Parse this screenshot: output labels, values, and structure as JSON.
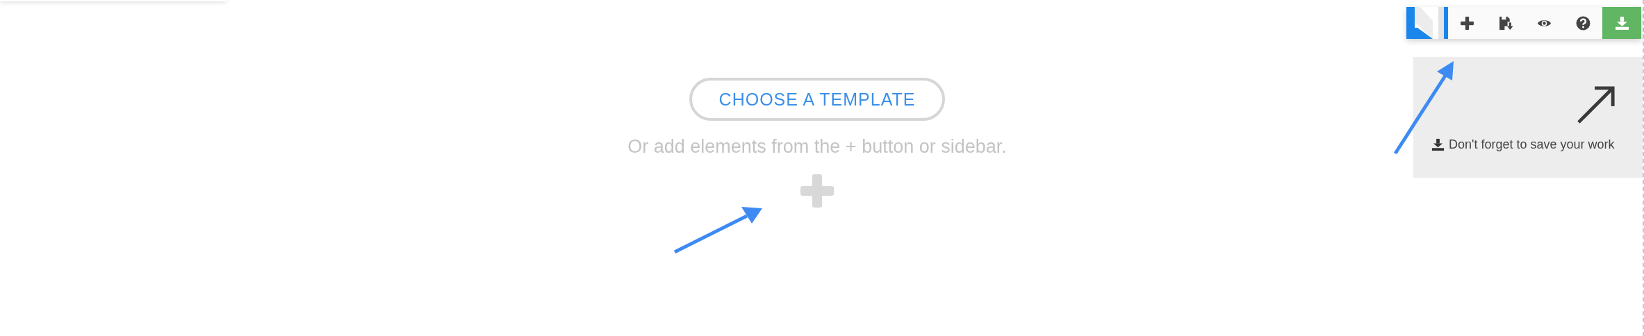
{
  "toolbar": {
    "buttons": [
      {
        "kind": "add"
      },
      {
        "kind": "save"
      },
      {
        "kind": "preview"
      },
      {
        "kind": "help"
      },
      {
        "kind": "download"
      }
    ]
  },
  "empty_state": {
    "button": "CHOOSE A TEMPLATE",
    "hint": "Or add elements from the + button or sidebar."
  },
  "save_tip": {
    "text": "Don't forget to save your work"
  }
}
